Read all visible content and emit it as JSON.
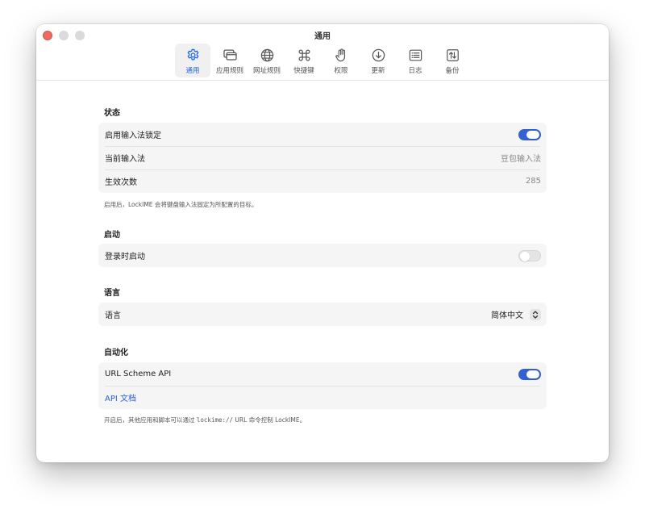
{
  "window": {
    "title": "通用"
  },
  "tabs": [
    {
      "label": "通用",
      "icon": "gear-icon",
      "active": true
    },
    {
      "label": "应用规则",
      "icon": "windows-icon",
      "active": false
    },
    {
      "label": "网址规则",
      "icon": "globe-icon",
      "active": false
    },
    {
      "label": "快捷键",
      "icon": "command-icon",
      "active": false
    },
    {
      "label": "权限",
      "icon": "hand-icon",
      "active": false
    },
    {
      "label": "更新",
      "icon": "download-icon",
      "active": false
    },
    {
      "label": "日志",
      "icon": "log-icon",
      "active": false
    },
    {
      "label": "备份",
      "icon": "backup-icon",
      "active": false
    }
  ],
  "status": {
    "title": "状态",
    "lock_label": "启用输入法锁定",
    "lock_enabled": true,
    "current_ime_label": "当前输入法",
    "current_ime_value": "豆包输入法",
    "count_label": "生效次数",
    "count_value": "285",
    "note": "启用后，LockIME 会将键盘输入法固定为所配置的目标。"
  },
  "startup": {
    "title": "启动",
    "login_label": "登录时启动",
    "login_enabled": false
  },
  "language": {
    "title": "语言",
    "label": "语言",
    "value": "简体中文"
  },
  "automation": {
    "title": "自动化",
    "api_label": "URL Scheme API",
    "api_enabled": true,
    "docs_link": "API 文档",
    "note_prefix": "开启后，其他应用和脚本可以通过 ",
    "note_code": "lockime://",
    "note_suffix": " URL 命令控制 LockIME。"
  },
  "colors": {
    "accent": "#3560d1",
    "active_tab": "#1f66e5",
    "group_bg": "#f5f5f5"
  }
}
